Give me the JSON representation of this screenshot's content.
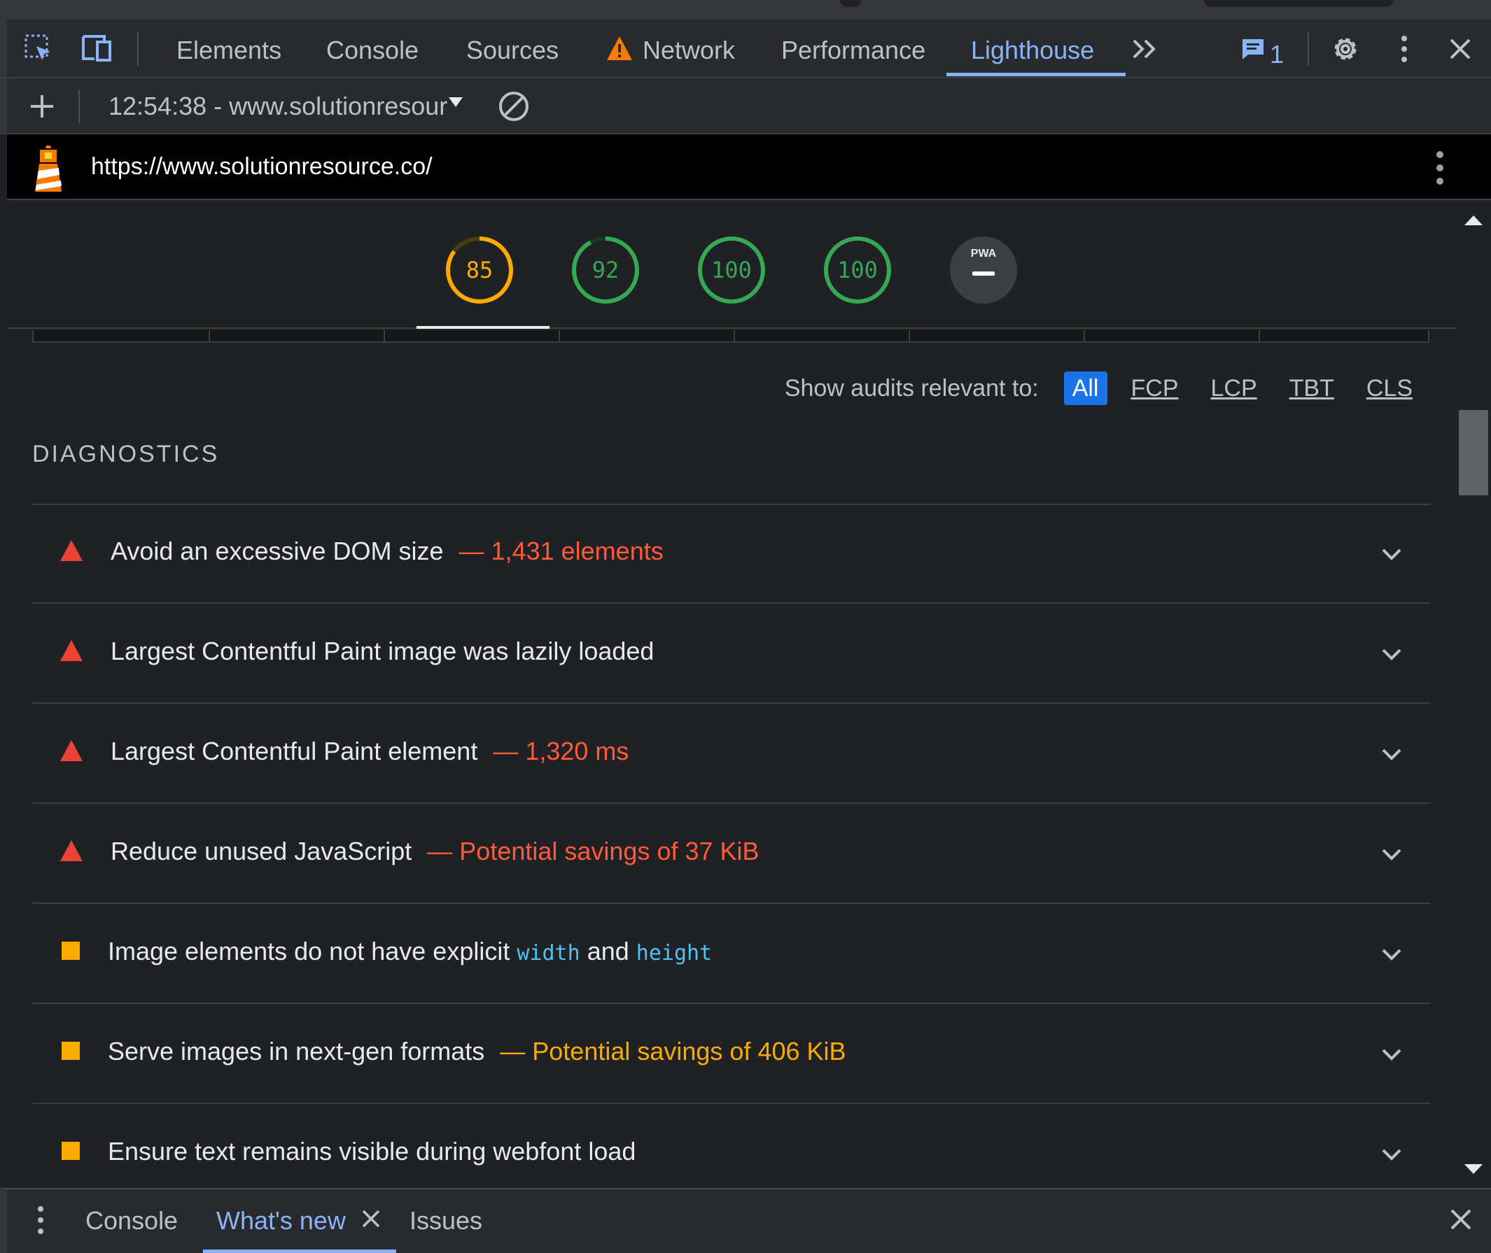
{
  "devtools_tabs": {
    "elements": "Elements",
    "console": "Console",
    "sources": "Sources",
    "network": "Network",
    "performance": "Performance",
    "lighthouse": "Lighthouse"
  },
  "issues_badge": {
    "count": "1"
  },
  "toolbar": {
    "report_selector": "12:54:38 - www.solutionresour"
  },
  "report": {
    "url": "https://www.solutionresource.co/",
    "scores": [
      {
        "value": "85",
        "rating": "average",
        "color": "#f9ab00",
        "fraction": 0.85
      },
      {
        "value": "92",
        "rating": "pass",
        "color": "#34a853",
        "fraction": 0.92
      },
      {
        "value": "100",
        "rating": "pass",
        "color": "#34a853",
        "fraction": 1.0
      },
      {
        "value": "100",
        "rating": "pass",
        "color": "#34a853",
        "fraction": 1.0
      }
    ],
    "pwa_badge": "PWA",
    "filter": {
      "label": "Show audits relevant to:",
      "chips": [
        "All",
        "FCP",
        "LCP",
        "TBT",
        "CLS"
      ],
      "selected": "All"
    },
    "section_title": "DIAGNOSTICS",
    "audits": [
      {
        "status": "fail",
        "title": "Avoid an excessive DOM size",
        "separator": "—",
        "display_value": "1,431 elements"
      },
      {
        "status": "fail",
        "title": "Largest Contentful Paint image was lazily loaded"
      },
      {
        "status": "fail",
        "title": "Largest Contentful Paint element",
        "separator": "—",
        "display_value": "1,320 ms"
      },
      {
        "status": "fail",
        "title": "Reduce unused JavaScript",
        "separator": "—",
        "display_value": "Potential savings of 37 KiB"
      },
      {
        "status": "average",
        "title_prefix": "Image elements do not have explicit",
        "code1": "width",
        "title_mid": "and",
        "code2": "height"
      },
      {
        "status": "average",
        "title": "Serve images in next-gen formats",
        "separator": "—",
        "display_value": "Potential savings of 406 KiB"
      },
      {
        "status": "average",
        "title": "Ensure text remains visible during webfont load"
      }
    ]
  },
  "drawer": {
    "console": "Console",
    "whats_new": "What's new",
    "issues": "Issues"
  },
  "colors": {
    "accent": "#8ab4f8",
    "fail": "#ff5a3a",
    "average": "#f9ab00",
    "pass": "#34a853",
    "code": "#4fc3f7",
    "chip_active": "#1a73e8"
  },
  "icons": [
    "inspect-element-icon",
    "device-toolbar-icon",
    "warning-icon",
    "more-tabs-icon",
    "issues-icon",
    "settings-gear-icon",
    "kebab-menu-icon",
    "close-icon",
    "add-icon",
    "dropdown-arrow-icon",
    "clear-icon",
    "lighthouse-logo-icon",
    "chevron-down-icon"
  ]
}
